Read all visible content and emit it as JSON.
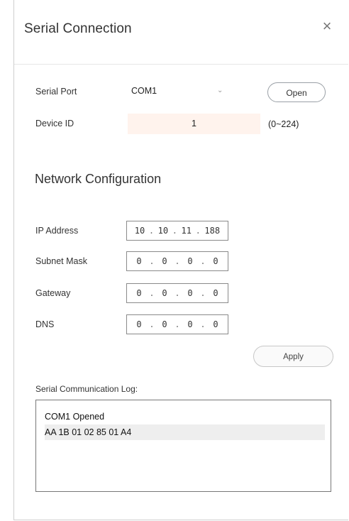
{
  "dialog": {
    "title": "Serial Connection",
    "close_symbol": "×"
  },
  "serial": {
    "port_label": "Serial Port",
    "port_value": "COM1",
    "dropdown_symbol": "⌄",
    "open_label": "Open",
    "device_id_label": "Device ID",
    "device_id_value": "1",
    "device_id_range": "(0~224)"
  },
  "network": {
    "section_title": "Network Configuration",
    "fields": [
      {
        "label": "IP Address",
        "octets": [
          "10",
          "10",
          "11",
          "188"
        ]
      },
      {
        "label": "Subnet Mask",
        "octets": [
          "0",
          "0",
          "0",
          "0"
        ]
      },
      {
        "label": "Gateway",
        "octets": [
          "0",
          "0",
          "0",
          "0"
        ]
      },
      {
        "label": "DNS",
        "octets": [
          "0",
          "0",
          "0",
          "0"
        ]
      }
    ],
    "apply_label": "Apply"
  },
  "log": {
    "label": "Serial Communication Log:",
    "lines": [
      "COM1 Opened",
      "AA 1B 01 02 85 01 A4"
    ]
  },
  "icons": {
    "close": "close-icon",
    "dropdown": "chevron-down-icon"
  }
}
